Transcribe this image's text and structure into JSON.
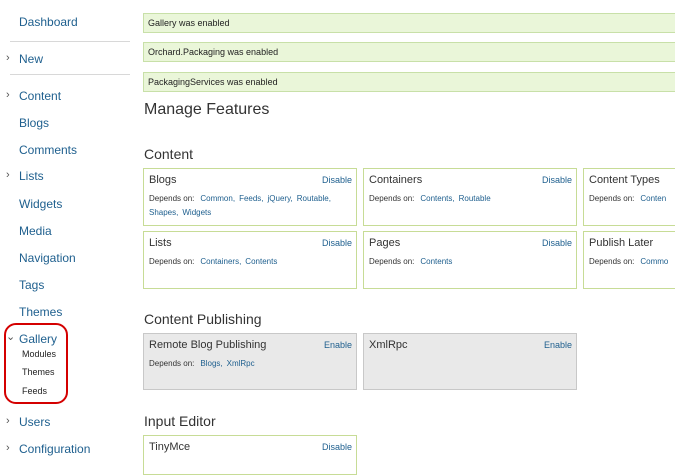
{
  "sidebar": {
    "dashboard": "Dashboard",
    "new": "New",
    "content": "Content",
    "blogs": "Blogs",
    "comments": "Comments",
    "lists": "Lists",
    "widgets": "Widgets",
    "media": "Media",
    "navigation": "Navigation",
    "tags": "Tags",
    "themes": "Themes",
    "gallery": "Gallery",
    "gallery_items": [
      "Modules",
      "Themes",
      "Feeds"
    ],
    "users": "Users",
    "configuration": "Configuration"
  },
  "messages": [
    "Gallery was enabled",
    "Orchard.Packaging was enabled",
    "PackagingServices was enabled"
  ],
  "page_title": "Manage Features",
  "depends_label": "Depends on:",
  "sections": [
    {
      "title": "Content",
      "features": [
        {
          "name": "Blogs",
          "action": "Disable",
          "deps": [
            "Common,",
            "Feeds,",
            "jQuery,",
            "Routable,",
            "Shapes,",
            "Widgets"
          ]
        },
        {
          "name": "Containers",
          "action": "Disable",
          "deps": [
            "Contents,",
            "Routable"
          ]
        },
        {
          "name": "Content Types",
          "action": "",
          "deps": [
            "Conten"
          ]
        },
        {
          "name": "Lists",
          "action": "Disable",
          "deps": [
            "Containers,",
            "Contents"
          ]
        },
        {
          "name": "Pages",
          "action": "Disable",
          "deps": [
            "Contents"
          ]
        },
        {
          "name": "Publish Later",
          "action": "",
          "deps": [
            "Commo"
          ]
        }
      ]
    },
    {
      "title": "Content Publishing",
      "features": [
        {
          "name": "Remote Blog Publishing",
          "action": "Enable",
          "deps": [
            "Blogs,",
            "XmlRpc"
          ]
        },
        {
          "name": "XmlRpc",
          "action": "Enable",
          "deps": []
        }
      ]
    },
    {
      "title": "Input Editor",
      "features": [
        {
          "name": "TinyMce",
          "action": "Disable",
          "deps": []
        }
      ]
    }
  ],
  "colors": {
    "link": "#1e5f8e",
    "message_bg": "#eaf6d9",
    "enabled_border": "#c7dc96",
    "disabled_bg": "#e9e9e9",
    "highlight": "#d40000"
  }
}
